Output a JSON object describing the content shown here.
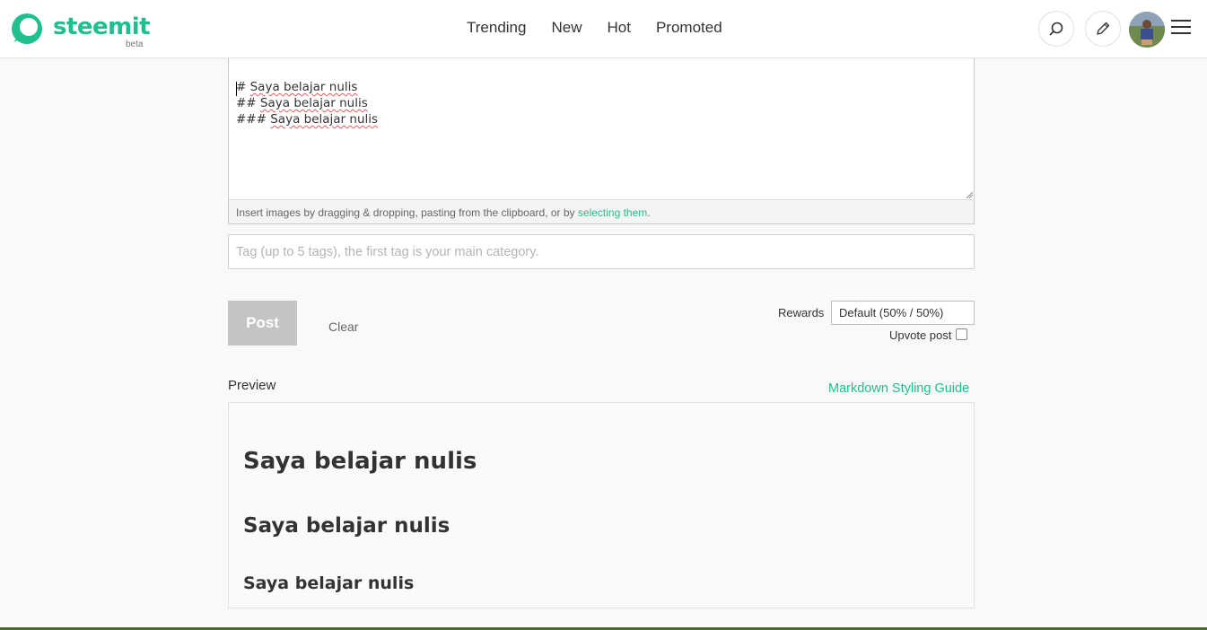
{
  "header": {
    "logo_text": "steemit",
    "logo_beta": "beta",
    "nav": [
      "Trending",
      "New",
      "Hot",
      "Promoted"
    ],
    "accent_color": "#1fbf8f"
  },
  "editor": {
    "lines": [
      {
        "prefix": "# ",
        "text": "Saya belajar nulis"
      },
      {
        "prefix": "## ",
        "text": "Saya belajar nulis"
      },
      {
        "prefix": "### ",
        "text": "Saya belajar nulis"
      }
    ],
    "hint_before": "Insert images by dragging & dropping, pasting from the clipboard, or by ",
    "hint_link": "selecting them",
    "hint_after": "."
  },
  "tags": {
    "placeholder": "Tag (up to 5 tags), the first tag is your main category.",
    "value": ""
  },
  "actions": {
    "post_label": "Post",
    "clear_label": "Clear",
    "rewards_label": "Rewards",
    "rewards_value": "Default (50% / 50%)",
    "upvote_label": "Upvote post"
  },
  "preview": {
    "label": "Preview",
    "guide_link": "Markdown Styling Guide",
    "h1": "Saya belajar nulis",
    "h2": "Saya belajar nulis",
    "h3": "Saya belajar nulis"
  }
}
